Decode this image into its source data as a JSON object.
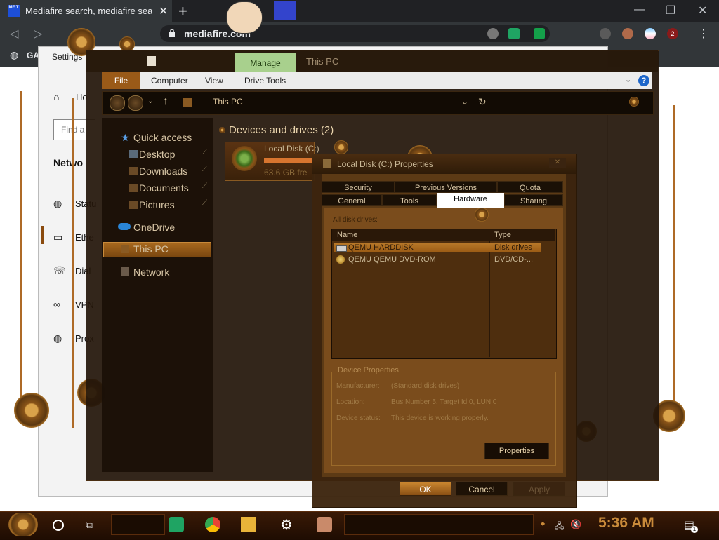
{
  "browser": {
    "tab_title": "Mediafire search, mediafire sea",
    "tab_favicon_text": "MF T",
    "url": "mediafire.com",
    "bookmark": "GA",
    "extension_badge": "2"
  },
  "settings": {
    "title": "Settings",
    "home_label": "Ho",
    "search_placeholder": "Find a",
    "network_heading": "Netwo",
    "items": [
      "Statu",
      "Ethe",
      "Dial",
      "VPN",
      "Prox"
    ]
  },
  "explorer": {
    "manage_tab": "Manage",
    "title": "This PC",
    "ribbon": {
      "file": "File",
      "computer": "Computer",
      "view": "View",
      "drive_tools": "Drive Tools"
    },
    "address": "This PC",
    "nav": {
      "quick_access": "Quick access",
      "desktop": "Desktop",
      "downloads": "Downloads",
      "documents": "Documents",
      "pictures": "Pictures",
      "onedrive": "OneDrive",
      "thispc": "This PC",
      "network": "Network"
    },
    "section": "Devices and drives (2)",
    "drive": {
      "name": "Local Disk (C:)",
      "free": "63.6 GB fre"
    }
  },
  "dialog": {
    "title": "Local Disk (C:) Properties",
    "tabs_row1": [
      "Security",
      "Previous Versions",
      "Quota"
    ],
    "tabs_row2": [
      "General",
      "Tools",
      "Hardware",
      "Sharing"
    ],
    "all_disk_drives_label": "All disk drives:",
    "columns": {
      "name": "Name",
      "type": "Type"
    },
    "rows": [
      {
        "name": "QEMU HARDDISK",
        "type": "Disk drives"
      },
      {
        "name": "QEMU QEMU DVD-ROM",
        "type": "DVD/CD-..."
      }
    ],
    "device_properties": {
      "legend": "Device Properties",
      "manufacturer_label": "Manufacturer:",
      "manufacturer": "(Standard disk drives)",
      "location_label": "Location:",
      "location": "Bus Number 5, Target Id 0, LUN 0",
      "status_label": "Device status:",
      "status": "This device is working properly.",
      "properties_button": "Properties"
    },
    "buttons": {
      "ok": "OK",
      "cancel": "Cancel",
      "apply": "Apply"
    }
  },
  "taskbar": {
    "clock": "5:36 AM",
    "notification_badge": "1"
  }
}
